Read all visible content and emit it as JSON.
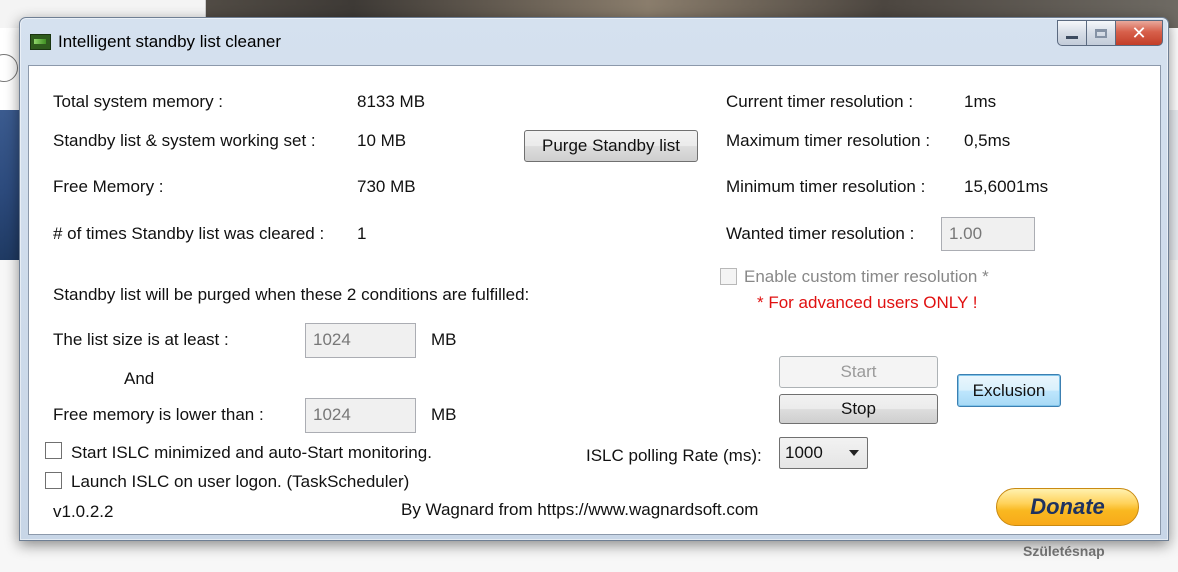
{
  "window": {
    "title": "Intelligent standby list cleaner"
  },
  "background": {
    "label": "Születésnap"
  },
  "memory": {
    "total_label": "Total system memory :",
    "total_value": "8133 MB",
    "standby_label": "Standby list & system working set :",
    "standby_value": "10 MB",
    "free_label": "Free Memory :",
    "free_value": "730 MB",
    "cleared_label": "# of times Standby list was cleared :",
    "cleared_value": "1"
  },
  "purge_button": "Purge Standby list",
  "timer": {
    "current_label": "Current timer resolution :",
    "current_value": "1ms",
    "max_label": "Maximum timer resolution :",
    "max_value": "0,5ms",
    "min_label": "Minimum timer resolution :",
    "min_value": "15,6001ms",
    "wanted_label": "Wanted timer resolution :",
    "wanted_value": "1.00",
    "custom_label": "Enable custom timer resolution *",
    "advanced_note": "* For advanced users ONLY !"
  },
  "conditions": {
    "heading": "Standby list will be purged when these 2 conditions are fulfilled:",
    "list_size_label": "The list size is at least :",
    "list_size_value": "1024",
    "list_size_unit": "MB",
    "and_label": "And",
    "free_lower_label": "Free memory is lower than :",
    "free_lower_value": "1024",
    "free_lower_unit": "MB"
  },
  "controls": {
    "start": "Start",
    "stop": "Stop",
    "exclusion": "Exclusion",
    "polling_label": "ISLC polling Rate (ms):",
    "polling_value": "1000"
  },
  "options": {
    "start_minimized": "Start ISLC minimized and auto-Start monitoring.",
    "launch_logon": "Launch ISLC on user logon. (TaskScheduler)"
  },
  "footer": {
    "version": "v1.0.2.2",
    "credits": "By Wagnard from https://www.wagnardsoft.com",
    "donate": "Donate"
  }
}
